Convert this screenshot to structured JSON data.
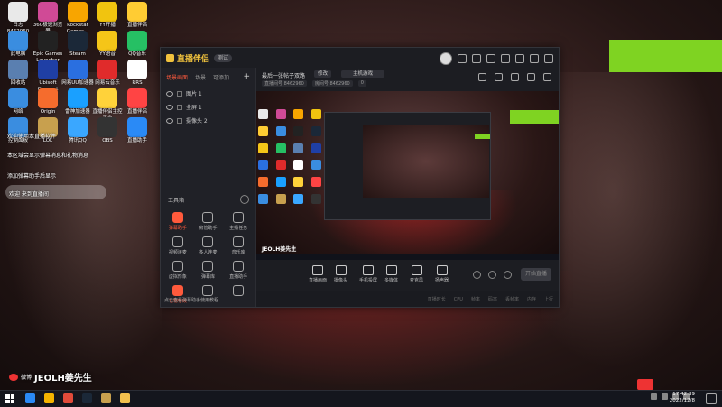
{
  "desktop": {
    "icons": [
      {
        "label": "日志\n8462960",
        "color": "#e9e9e9"
      },
      {
        "label": "360极速浏览器",
        "color": "#d04a96"
      },
      {
        "label": "Rockstar Games...",
        "color": "#f8a500"
      },
      {
        "label": "YY开播",
        "color": "#f1c40f"
      },
      {
        "label": "直播伴侣",
        "color": "#ffcc33"
      },
      {
        "label": "此电脑",
        "color": "#3a8de0"
      },
      {
        "label": "Epic Games Launcher",
        "color": "#222222"
      },
      {
        "label": "Steam",
        "color": "#1b2838"
      },
      {
        "label": "YY语音",
        "color": "#f5c518"
      },
      {
        "label": "QQ音乐",
        "color": "#26c064"
      },
      {
        "label": "回收站",
        "color": "#5a7fb0"
      },
      {
        "label": "Ubisoft Connect",
        "color": "#1f3fa5"
      },
      {
        "label": "网易UU加速器",
        "color": "#2a6fe0"
      },
      {
        "label": "网易云音乐",
        "color": "#e02b2b"
      },
      {
        "label": "RRS",
        "color": "#ffffff"
      },
      {
        "label": "网络",
        "color": "#3a8de0"
      },
      {
        "label": "Origin",
        "color": "#f56c2d"
      },
      {
        "label": "雷神加速器",
        "color": "#1aa0ff"
      },
      {
        "label": "直播伴侣主控平台",
        "color": "#ffd23a"
      },
      {
        "label": "直播伴侣",
        "color": "#ff4444"
      },
      {
        "label": "控制面板",
        "color": "#3a8de0"
      },
      {
        "label": "LOL",
        "color": "#c8a04e"
      },
      {
        "label": "腾讯QQ",
        "color": "#3aa7ff"
      },
      {
        "label": "OBS",
        "color": "#333333"
      },
      {
        "label": "直播助手",
        "color": "#2a8af6"
      }
    ],
    "notices": [
      "欢迎使用本直播软件",
      "本区域会显示弹幕消息和礼物消息",
      "添加弹幕助手后显示",
      "欢迎 来到直播间"
    ],
    "weibo_prefix": "微博",
    "weibo_name": "JEOLH姜先生"
  },
  "app": {
    "name": "直播伴侣",
    "version_badge": "测试",
    "source_tabs": [
      "场景画面",
      "场景",
      "可添加"
    ],
    "source_add": "+",
    "sources": [
      {
        "label": "图片 1"
      },
      {
        "label": "全屏 1"
      },
      {
        "label": "摄像头 2"
      }
    ],
    "tools_title": "工具箱",
    "tools": [
      {
        "label": "弹幕助手",
        "hot": true
      },
      {
        "label": "房管助手",
        "hot": false
      },
      {
        "label": "主播任务",
        "hot": false
      },
      {
        "label": "视频连麦",
        "hot": false
      },
      {
        "label": "多人连麦",
        "hot": false
      },
      {
        "label": "音乐库",
        "hot": false
      },
      {
        "label": "虚拟形象",
        "hot": false
      },
      {
        "label": "弹幕库",
        "hot": false
      },
      {
        "label": "直播助手",
        "hot": false
      },
      {
        "label": "礼物特效",
        "hot": true
      },
      {
        "label": "",
        "hot": false
      },
      {
        "label": "",
        "hot": false
      }
    ],
    "sidebar_footer": "点击查看弹幕助手使用教程",
    "room_title": "最后一张帖子双路",
    "tag_edit": "修改",
    "tag_category": "主机游戏",
    "room_meta": [
      "直播间号 8462960",
      "房间号 8462960",
      "0"
    ],
    "controls": [
      {
        "label": "直播画面"
      },
      {
        "label": "摄像头"
      },
      {
        "label": "手机投屏"
      },
      {
        "label": "多媒体"
      },
      {
        "label": "麦克风"
      },
      {
        "label": "扬声器"
      }
    ],
    "live_button": "开始直播",
    "status": [
      "直播时长",
      "CPU",
      "帧率",
      "码率",
      "丢帧率",
      "内存",
      "上行"
    ],
    "preview_watermark": "JEOLH姜先生"
  },
  "taskbar": {
    "apps": [
      {
        "name": "edge",
        "color": "#2a8af6"
      },
      {
        "name": "chrome",
        "color": "#f4b400"
      },
      {
        "name": "browser",
        "color": "#e04b3a"
      },
      {
        "name": "steam",
        "color": "#1b2838"
      },
      {
        "name": "game",
        "color": "#c8a04e"
      },
      {
        "name": "folder",
        "color": "#f2c14e"
      }
    ],
    "time": "17:42:39",
    "date": "2022/12/8"
  }
}
